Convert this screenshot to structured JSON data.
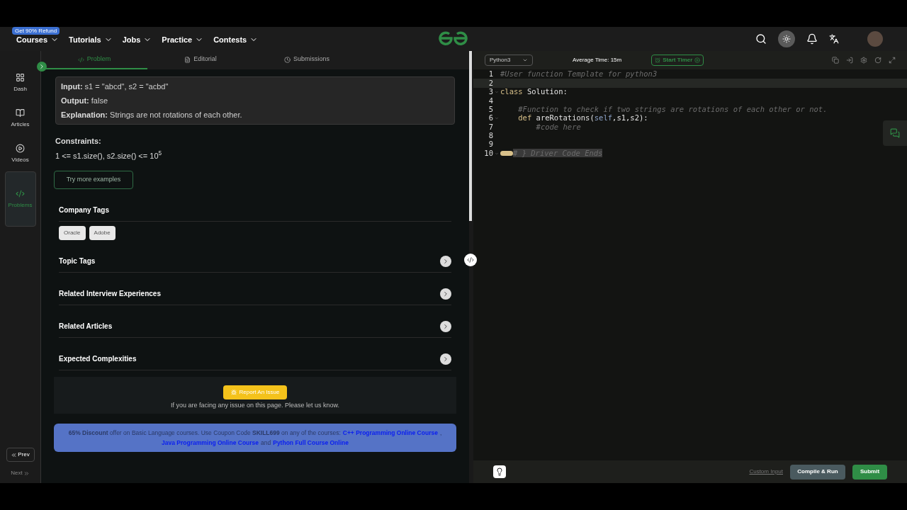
{
  "nav": {
    "refund_badge": "Get 90% Refund",
    "menus": [
      {
        "label": "Courses"
      },
      {
        "label": "Tutorials"
      },
      {
        "label": "Jobs"
      },
      {
        "label": "Practice"
      },
      {
        "label": "Contests"
      }
    ]
  },
  "sidebar": {
    "items": [
      {
        "label": "Dash",
        "selected": false
      },
      {
        "label": "Articles",
        "selected": false
      },
      {
        "label": "Videos",
        "selected": false
      },
      {
        "label": "Problems",
        "selected": true
      }
    ],
    "prev": "Prev",
    "next": "Next"
  },
  "tabs": [
    {
      "label": "Problem",
      "selected": true
    },
    {
      "label": "Editorial",
      "selected": false
    },
    {
      "label": "Submissions",
      "selected": false
    }
  ],
  "example": [
    {
      "label": "Input:",
      "value": "s1 = \"abcd\", s2 = \"acbd\""
    },
    {
      "label": "Output:",
      "value": "false"
    },
    {
      "label": "Explanation:",
      "value": "Strings are not rotations of each other."
    }
  ],
  "constraints": {
    "title": "Constraints:",
    "text": "1 <= s1.size(), s2.size() <= 10$^{5}$"
  },
  "try_more": "Try more examples",
  "company_tags": {
    "title": "Company Tags",
    "tags": [
      "Oracle",
      "Adobe"
    ]
  },
  "sections": [
    {
      "title": "Topic Tags",
      "expanded": false
    },
    {
      "title": "Related Interview Experiences",
      "expanded": false
    },
    {
      "title": "Related Articles",
      "expanded": false
    },
    {
      "title": "Expected Complexities",
      "expanded": false
    }
  ],
  "report": {
    "button": "Report An Issue",
    "text": "If you are facing any issue on this page. Please let us know."
  },
  "promo": [
    {
      "kind": "text",
      "text": "**65% Discount** offer on Basic Language courses. Use Coupon Code **SKILL699** on any of the courses:"
    },
    {
      "kind": "link",
      "text": "C++ Programming Online Course"
    },
    {
      "kind": "text",
      "text": ","
    },
    {
      "kind": "link",
      "text": "Java Programming Online Course"
    },
    {
      "kind": "text",
      "text": "and"
    },
    {
      "kind": "link",
      "text": "Python Full Course Online"
    }
  ],
  "editor": {
    "language": "Python3",
    "average_time": "Average Time: 15m",
    "timer": "Start Timer",
    "lines": [
      {
        "number": "1",
        "fold": false,
        "segments": [
          {
            "kind": "comment",
            "text": "#User function Template for python3"
          }
        ]
      },
      {
        "number": "2",
        "fold": false,
        "current": true
      },
      {
        "number": "3",
        "fold": true,
        "segments": [
          {
            "kind": "keyword",
            "text": "class"
          },
          {
            "kind": "plain",
            "text": " Solution:"
          }
        ]
      },
      {
        "number": "4",
        "fold": false
      },
      {
        "number": "5",
        "fold": false,
        "segments": [
          {
            "kind": "comment",
            "text": "    #Function to check if two strings are rotations of each other or not."
          }
        ]
      },
      {
        "number": "6",
        "fold": true,
        "segments": [
          {
            "kind": "keyword",
            "text": "    def"
          },
          {
            "kind": "plain",
            "text": " areRotations("
          },
          {
            "kind": "self",
            "text": "self"
          },
          {
            "kind": "plain",
            "text": ",s1,s2):"
          }
        ]
      },
      {
        "number": "7",
        "fold": false,
        "segments": [
          {
            "kind": "comment",
            "text": "        #code here"
          }
        ]
      },
      {
        "number": "8",
        "fold": false
      },
      {
        "number": "9",
        "fold": false
      },
      {
        "number": "10",
        "fold": true,
        "folded": true,
        "segments": [
          {
            "kind": "folded",
            "text": "# } Driver Code Ends"
          }
        ]
      }
    ]
  },
  "footer": {
    "custom_input": "Custom Input",
    "compile": "Compile & Run",
    "submit": "Submit"
  }
}
